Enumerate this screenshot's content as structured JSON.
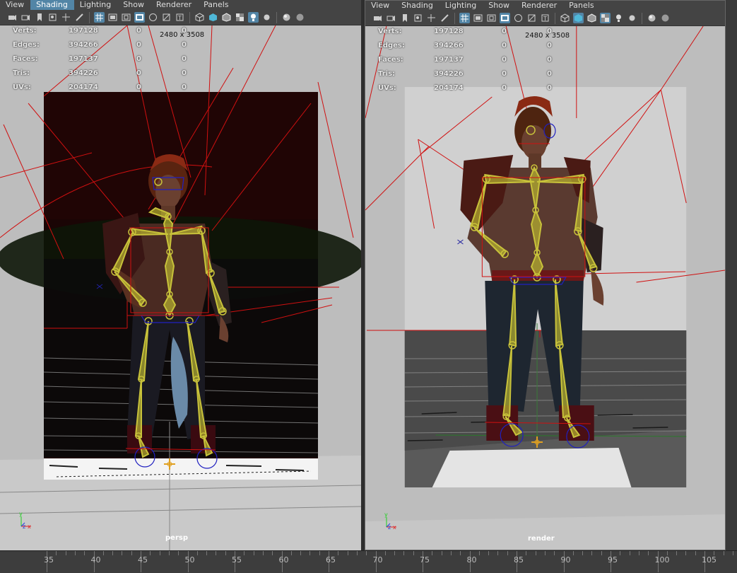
{
  "panels": [
    {
      "id": "left",
      "menu": [
        "View",
        "Shading",
        "Lighting",
        "Show",
        "Renderer",
        "Panels"
      ],
      "active_menu": "Shading",
      "hud": [
        {
          "label": "Verts:",
          "v1": "197128",
          "v2": "0",
          "v3": "0"
        },
        {
          "label": "Edges:",
          "v1": "394266",
          "v2": "0",
          "v3": "0"
        },
        {
          "label": "Faces:",
          "v1": "197137",
          "v2": "0",
          "v3": "0"
        },
        {
          "label": "Tris:",
          "v1": "394226",
          "v2": "0",
          "v3": "0"
        },
        {
          "label": "UVs:",
          "v1": "204174",
          "v2": "0",
          "v3": "0"
        }
      ],
      "resolution": "2480 x 3508",
      "camera": "persp",
      "axis_labels": [
        "y",
        "z",
        "x"
      ]
    },
    {
      "id": "right",
      "menu": [
        "View",
        "Shading",
        "Lighting",
        "Show",
        "Renderer",
        "Panels"
      ],
      "active_menu": "",
      "hud": [
        {
          "label": "Verts:",
          "v1": "197128",
          "v2": "0",
          "v3": "0"
        },
        {
          "label": "Edges:",
          "v1": "394266",
          "v2": "0",
          "v3": "0"
        },
        {
          "label": "Faces:",
          "v1": "197137",
          "v2": "0",
          "v3": "0"
        },
        {
          "label": "Tris:",
          "v1": "394226",
          "v2": "0",
          "v3": "0"
        },
        {
          "label": "UVs:",
          "v1": "204174",
          "v2": "0",
          "v3": "0"
        }
      ],
      "resolution": "2480 x 3508",
      "camera": "render",
      "axis_labels": [
        "y",
        "z",
        "x"
      ]
    }
  ],
  "timeline": {
    "labels": [
      "35",
      "40",
      "45",
      "50",
      "55",
      "60",
      "65",
      "70",
      "75",
      "80",
      "85",
      "90",
      "95",
      "100",
      "105"
    ]
  },
  "colors": {
    "accent": "#5285a6",
    "joint": "#c8c23a",
    "curve": "#d01010",
    "control": "#2020c0"
  }
}
